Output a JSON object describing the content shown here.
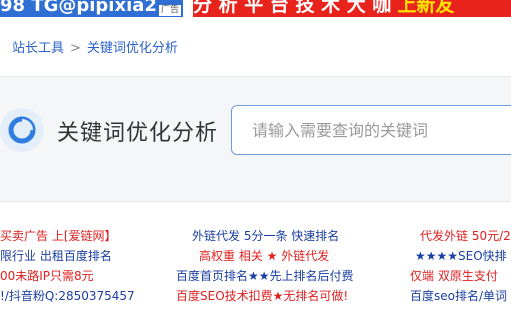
{
  "top_banners": {
    "left_text": "98  TG@pipixia2",
    "left_ad_tag": "广告",
    "right_text": "分 析 平 台 技 术 大 咖",
    "right_highlight": "上新友"
  },
  "breadcrumb": {
    "home": "站长工具",
    "separator": ">",
    "current": "关键词优化分析"
  },
  "hero": {
    "title": "关键词优化分析",
    "search_placeholder": "请输入需要查询的关键词",
    "search_value": ""
  },
  "ads": {
    "col1": [
      {
        "text": "买卖广告 上[爱链网】",
        "color": "red"
      },
      {
        "text": "限行业 出租百度排名",
        "color": "blue"
      },
      {
        "text": "00未路IP只需8元",
        "color": "red"
      },
      {
        "text": "!/抖音粉Q:2850375457",
        "color": "blue"
      }
    ],
    "col2": [
      {
        "text": "外链代发 5分一条 快速排名",
        "color": "blue"
      },
      {
        "text": "高权重 相关 ★ 外链代发",
        "color": "red"
      },
      {
        "text": "百度首页排名★★先上排名后付费",
        "color": "blue"
      },
      {
        "text": "百度SEO技术扣费★无排名可做!",
        "color": "red"
      }
    ],
    "col3": [
      {
        "text": "代发外链 50元/2",
        "color": "red"
      },
      {
        "text": "★★★★SEO快排",
        "color": "blue"
      },
      {
        "text": "仅端 双原生支付",
        "color": "red"
      },
      {
        "text": "百度seo排名/单词",
        "color": "blue"
      }
    ]
  },
  "colors": {
    "link_blue": "#2a62c9",
    "ad_red": "#e02020",
    "ad_blue": "#1a3fa0",
    "banner_red": "#e8231c",
    "banner_blue": "#2f6fd4"
  }
}
